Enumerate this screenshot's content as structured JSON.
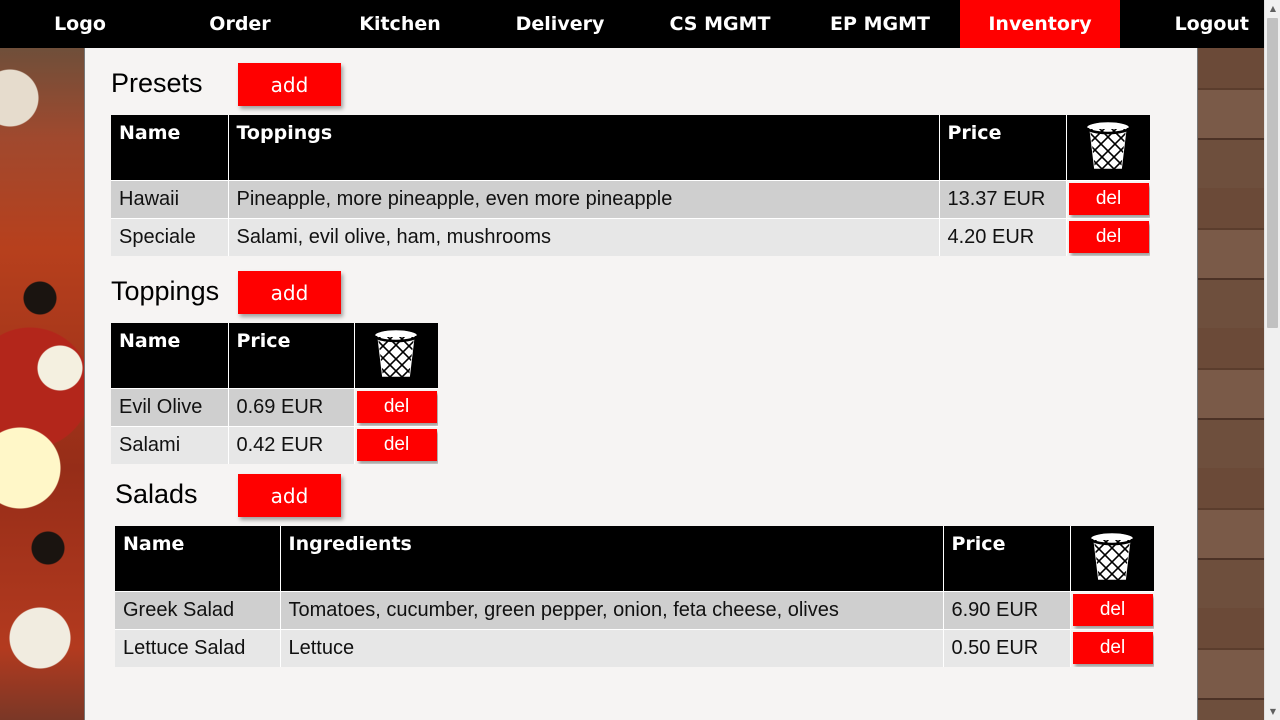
{
  "nav": {
    "items": [
      {
        "label": "Logo"
      },
      {
        "label": "Order"
      },
      {
        "label": "Kitchen"
      },
      {
        "label": "Delivery"
      },
      {
        "label": "CS MGMT"
      },
      {
        "label": "EP MGMT"
      },
      {
        "label": "Inventory"
      },
      {
        "label": "Logout"
      }
    ],
    "active": "Inventory",
    "active_color": "#ff0000"
  },
  "add_label": "add",
  "del_label": "del",
  "presets": {
    "title": "Presets",
    "columns": [
      "Name",
      "Toppings",
      "Price"
    ],
    "delete_icon": "trash-icon",
    "rows": [
      {
        "name": "Hawaii",
        "toppings": "Pineapple, more pineapple, even more pineapple",
        "price": "13.37 EUR"
      },
      {
        "name": "Speciale",
        "toppings": "Salami, evil olive, ham, mushrooms",
        "price": "4.20 EUR"
      }
    ]
  },
  "toppings": {
    "title": "Toppings",
    "columns": [
      "Name",
      "Price"
    ],
    "delete_icon": "trash-icon",
    "rows": [
      {
        "name": "Evil Olive",
        "price": "0.69 EUR"
      },
      {
        "name": "Salami",
        "price": "0.42 EUR"
      }
    ]
  },
  "salads": {
    "title": "Salads",
    "columns": [
      "Name",
      "Ingredients",
      "Price"
    ],
    "delete_icon": "trash-icon",
    "rows": [
      {
        "name": "Greek Salad",
        "ingredients": "Tomatoes, cucumber, green pepper, onion, feta cheese, olives",
        "price": "6.90 EUR"
      },
      {
        "name": "Lettuce Salad",
        "ingredients": "Lettuce",
        "price": "0.50 EUR"
      }
    ]
  }
}
